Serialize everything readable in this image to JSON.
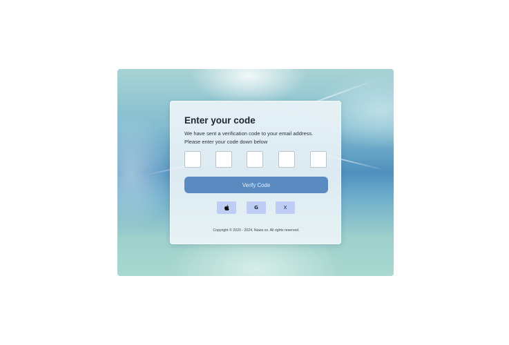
{
  "auth": {
    "title": "Enter your code",
    "subtitle_line1": "We have sent a verification code to your email address.",
    "subtitle_line2": "Please enter your code down below",
    "code_digits": [
      "",
      "",
      "",
      "",
      ""
    ],
    "verify_label": "Verify Code",
    "social": [
      {
        "icon": "apple-icon"
      },
      {
        "icon": "google-icon",
        "glyph": "G"
      },
      {
        "icon": "x-icon",
        "glyph": "X"
      }
    ],
    "copyright": "Copyright © 2020 - 2024, Nuwa co. All rights reserved."
  },
  "colors": {
    "accent": "#5b8ac1",
    "social_button": "#bfcdf4",
    "card": "#ecf4f7"
  }
}
